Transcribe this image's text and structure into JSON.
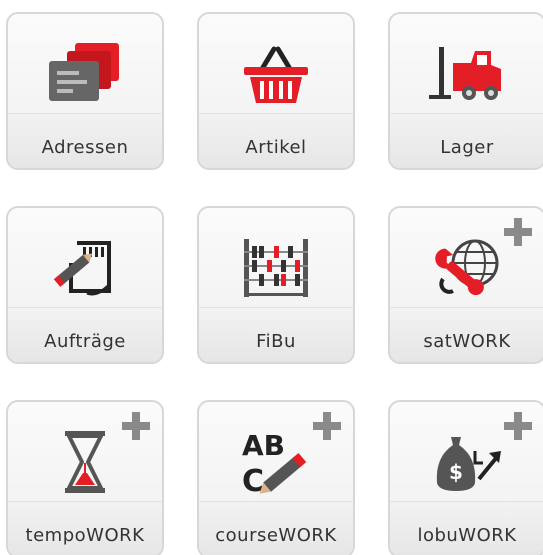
{
  "tiles": [
    {
      "label": "Adressen",
      "icon": "address-cards-icon"
    },
    {
      "label": "Artikel",
      "icon": "shopping-basket-icon"
    },
    {
      "label": "Lager",
      "icon": "forklift-icon"
    },
    {
      "label": "Aufträge",
      "icon": "order-sign-icon"
    },
    {
      "label": "FiBu",
      "icon": "abacus-icon"
    },
    {
      "label": "satWORK",
      "icon": "wrench-globe-icon",
      "addon": "plus"
    },
    {
      "label": "tempoWORK",
      "icon": "hourglass-icon",
      "addon": "plus"
    },
    {
      "label": "courseWORK",
      "icon": "abc-pencil-icon",
      "addon": "plus",
      "icon_text": [
        "AB",
        "C"
      ]
    },
    {
      "label": "lobuWORK",
      "icon": "money-bag-arrow-icon",
      "addon": "plus",
      "icon_text": "$"
    }
  ],
  "colors": {
    "accent": "#e41e26",
    "icon_dark": "#4a4a4a",
    "plus": "#8a8a8a",
    "tile_border": "#d7d7d7"
  }
}
